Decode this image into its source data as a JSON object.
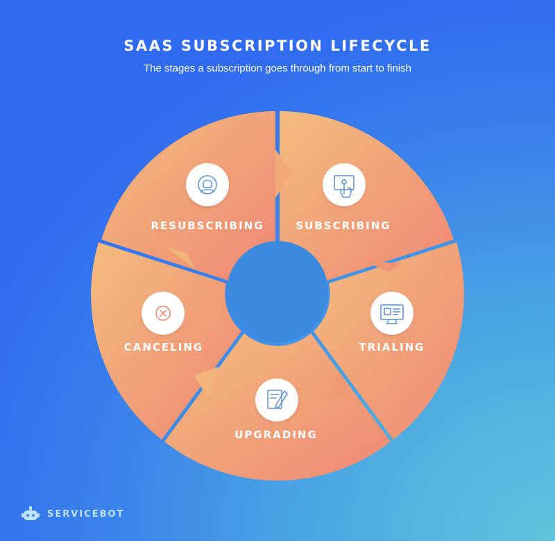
{
  "header": {
    "title": "SAAS SUBSCRIPTION LIFECYCLE",
    "subtitle": "The stages a subscription goes through from start to finish"
  },
  "stages": [
    {
      "label": "SUBSCRIBING",
      "icon": "touch-screen-icon"
    },
    {
      "label": "TRIALING",
      "icon": "monitor-dashboard-icon"
    },
    {
      "label": "UPGRADING",
      "icon": "document-pen-icon"
    },
    {
      "label": "CANCELING",
      "icon": "cancel-x-icon"
    },
    {
      "label": "RESUBSCRIBING",
      "icon": "user-avatar-icon"
    }
  ],
  "brand": {
    "name": "SERVICEBOT",
    "icon": "robot-icon"
  },
  "colors": {
    "segment_light": "#f2b77c",
    "segment_dark": "#ee8c74",
    "icon_stroke": "#5a8fd6",
    "cancel_icon": "#ee8c74"
  }
}
